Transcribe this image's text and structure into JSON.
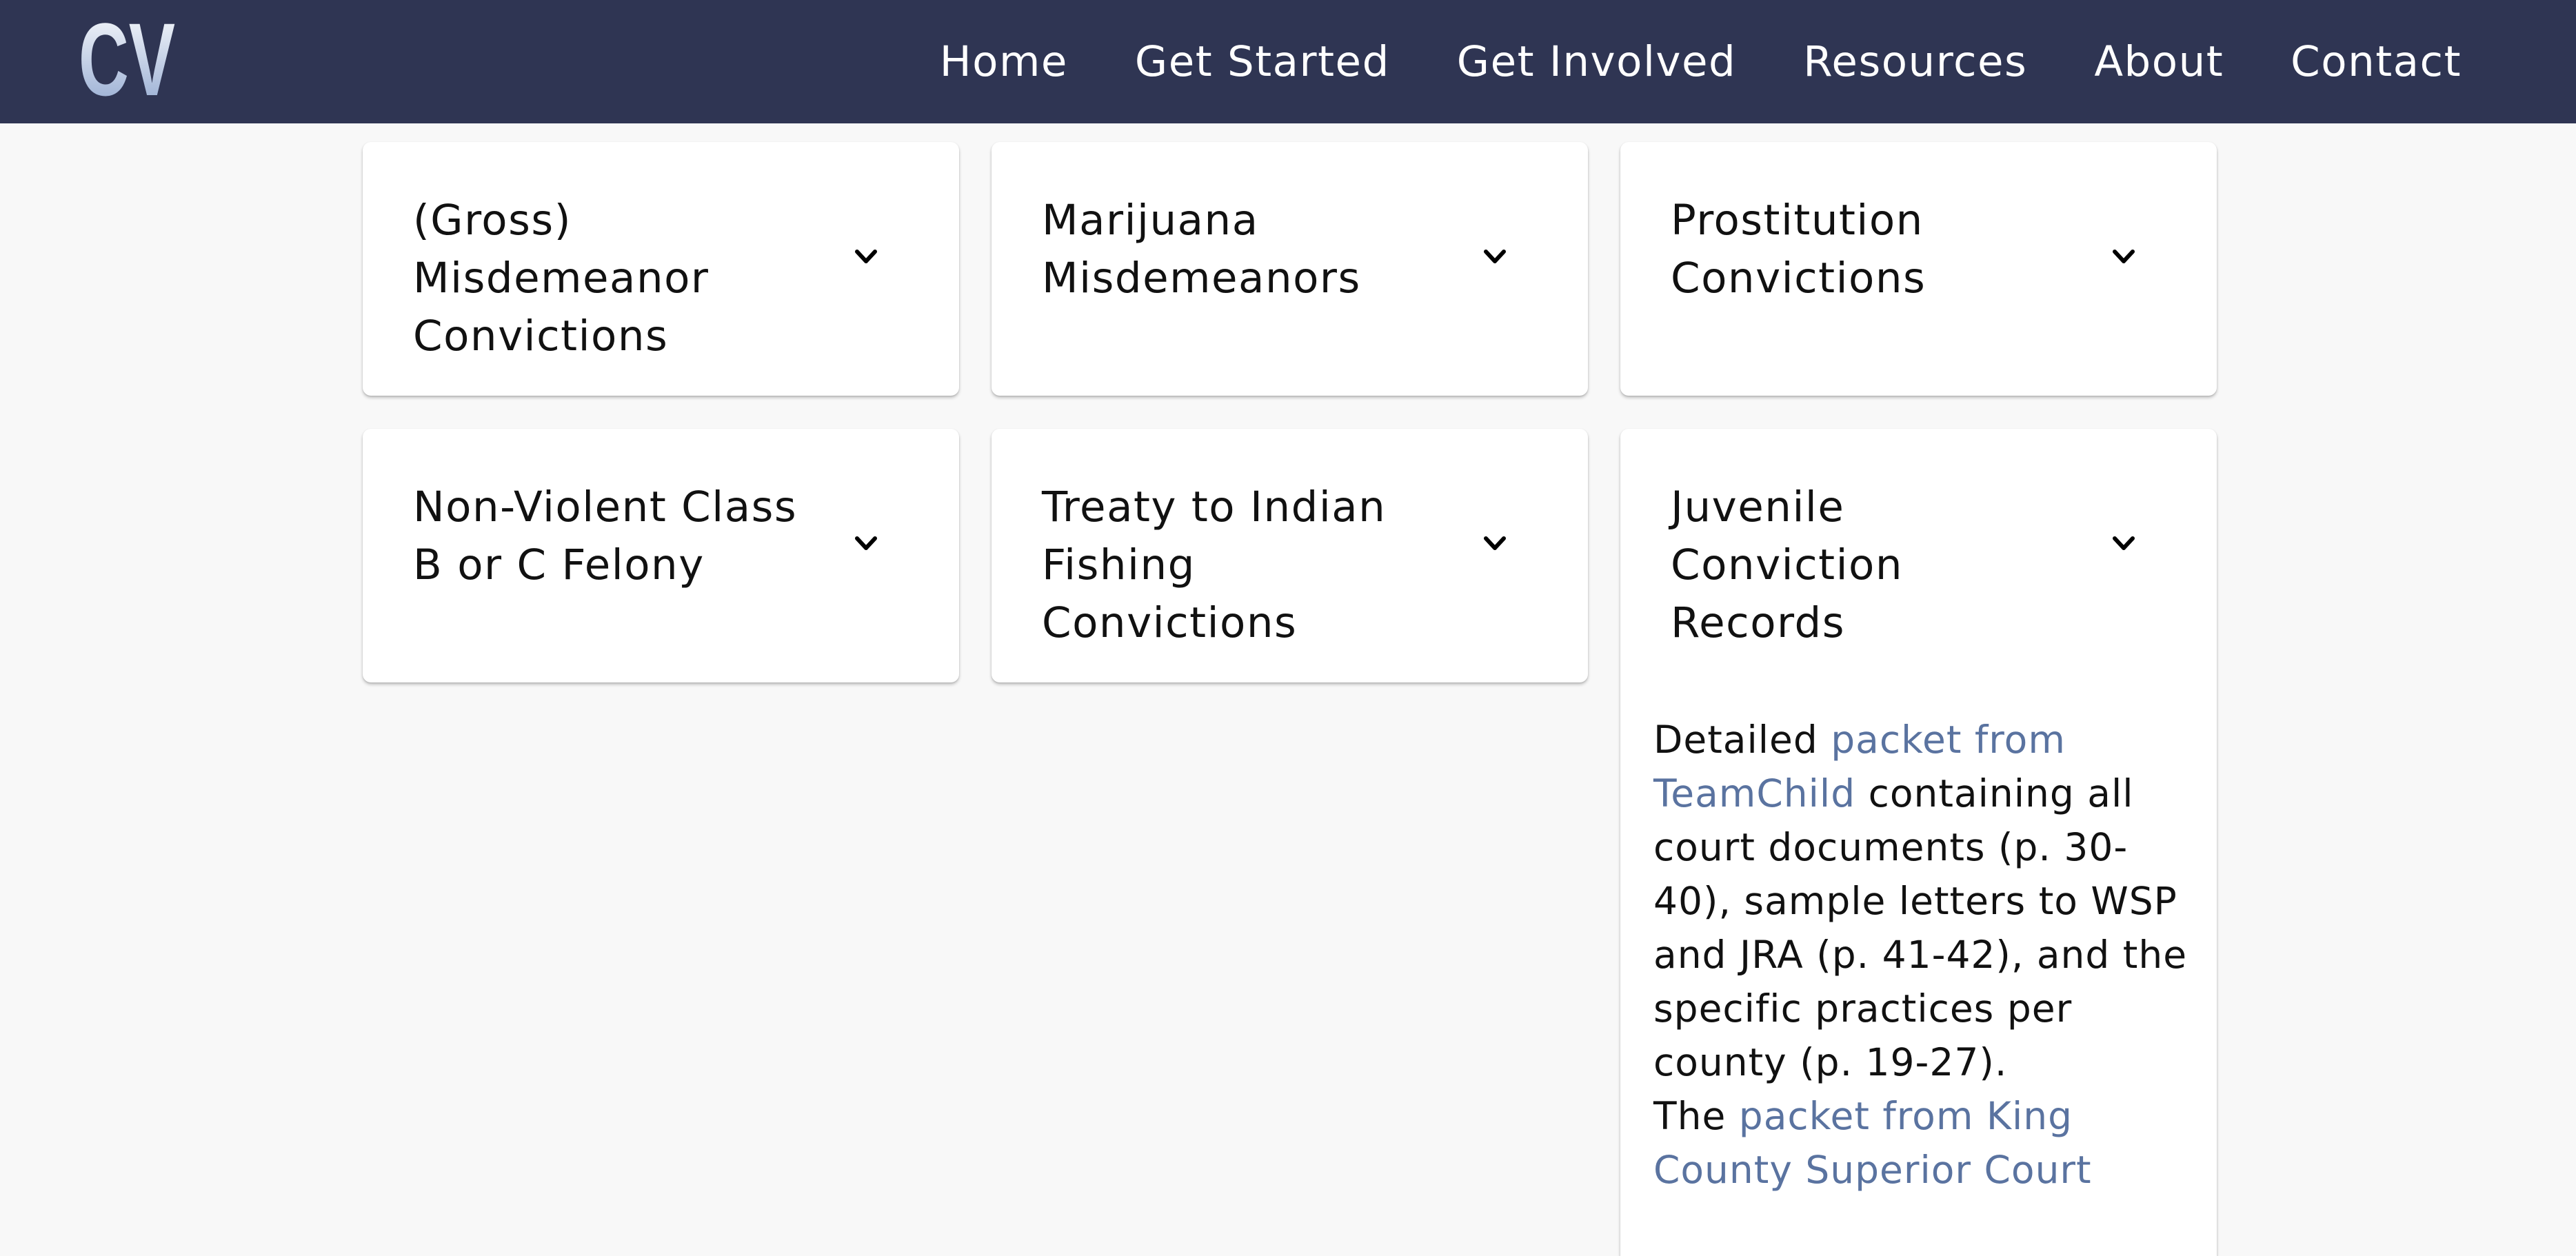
{
  "header": {
    "logo_text": "CV",
    "nav": [
      "Home",
      "Get Started",
      "Get Involved",
      "Resources",
      "About",
      "Contact"
    ]
  },
  "cards": [
    {
      "title": "(Gross) Misdemeanor Convictions"
    },
    {
      "title": "Marijuana Misdemeanors"
    },
    {
      "title": "Prostitution Convictions"
    },
    {
      "title": "Non-Violent Class B or C Felony"
    },
    {
      "title": "Treaty to Indian Fishing Convictions"
    },
    {
      "title": "Juvenile Conviction Records"
    }
  ],
  "juvenile_body": {
    "p1_prefix": "Detailed ",
    "p1_link": "packet from TeamChild",
    "p1_suffix": " containing all court documents (p. 30-40), sample letters to WSP and JRA (p. 41-42), and the specific practices per county (p. 19-27).",
    "p2_prefix": "The ",
    "p2_link": "packet from King County Superior Court"
  },
  "colors": {
    "header_bg": "#2f3553",
    "link": "#5a73a0",
    "page_bg": "#f8f8f8"
  },
  "icons": {
    "card_toggle": "chevron-down-icon"
  }
}
